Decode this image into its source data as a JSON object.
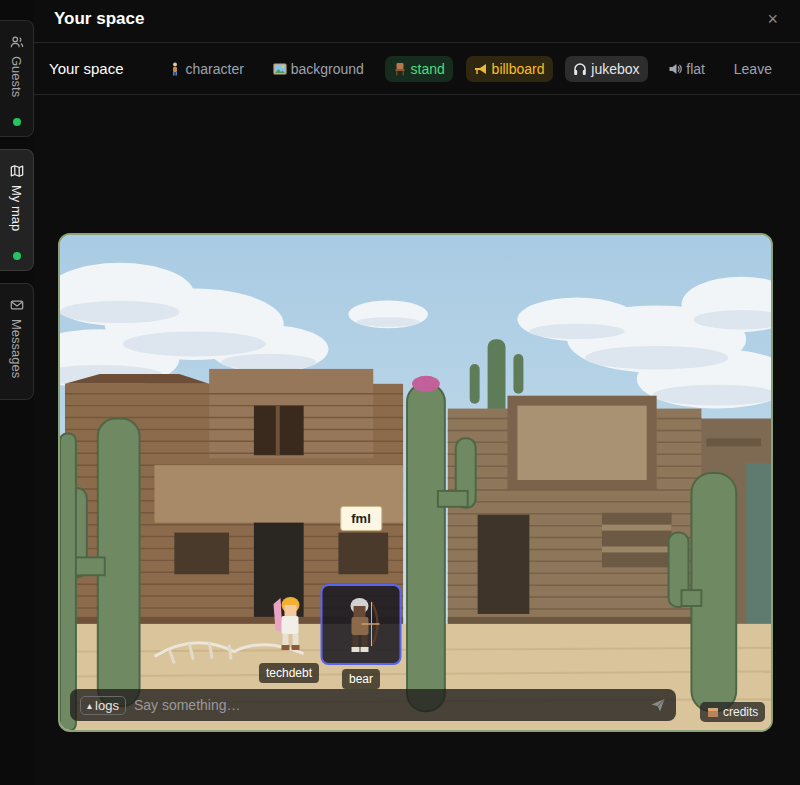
{
  "window": {
    "title": "Your space",
    "close": "×"
  },
  "sidebar": {
    "items": [
      {
        "label": "Guests",
        "selected": false,
        "online": true
      },
      {
        "label": "My map",
        "selected": true,
        "online": true
      },
      {
        "label": "Messages",
        "selected": false,
        "online": false
      }
    ]
  },
  "toolbar": {
    "label": "Your space",
    "tools": [
      {
        "label": "character",
        "highlighted": false,
        "color": "#9ca3af"
      },
      {
        "label": "background",
        "highlighted": false,
        "color": "#9ca3af"
      },
      {
        "label": "stand",
        "highlighted": true,
        "color": "#4ade80"
      },
      {
        "label": "billboard",
        "highlighted": true,
        "color": "#fbbf24"
      },
      {
        "label": "jukebox",
        "highlighted": true,
        "color": "#e5e7eb"
      },
      {
        "label": "flat",
        "highlighted": false,
        "color": "#9ca3af"
      }
    ],
    "leave": "Leave"
  },
  "scene": {
    "players": [
      {
        "name": "techdebt",
        "selected": false,
        "bubble": ""
      },
      {
        "name": "bear",
        "selected": true,
        "bubble": "fml"
      }
    ]
  },
  "chat": {
    "logs_icon": "▴",
    "logs": "logs",
    "placeholder": "Say something…"
  },
  "credits": "credits"
}
